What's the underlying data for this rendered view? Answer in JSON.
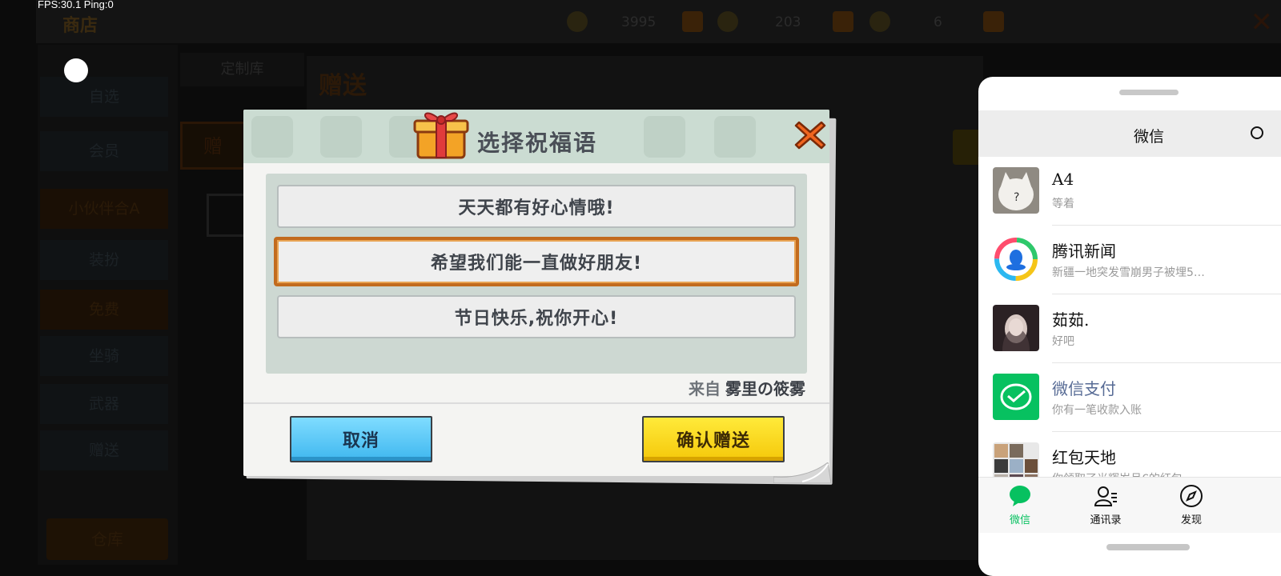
{
  "overlay": {
    "fps_text": "FPS:30.1 Ping:0"
  },
  "game_background": {
    "title": "商店",
    "currencies": [
      "3995",
      "203",
      "6"
    ],
    "sidebar": [
      "自选",
      "会员",
      "小伙伴合A",
      "装扮",
      "免费",
      "坐骑",
      "武器",
      "赠送"
    ],
    "sidebar_bottom": "仓库",
    "tab_library": "定制库",
    "panel_title": "赠送",
    "tab_active": "赠"
  },
  "dialog": {
    "title": "选择祝福语",
    "options": [
      {
        "text": "天天都有好心情哦!",
        "selected": false
      },
      {
        "text": "希望我们能一直做好朋友!",
        "selected": true
      },
      {
        "text": "节日快乐,祝你开心!",
        "selected": false
      }
    ],
    "from_label": "来自",
    "from_name": "雾里の筱雾",
    "cancel_label": "取消",
    "confirm_label": "确认赠送",
    "colors": {
      "cancel": "#4cc3f5",
      "confirm": "#f8d317",
      "selected_border": "#c26b1e"
    }
  },
  "wechat": {
    "title": "微信",
    "chats": [
      {
        "name": "A4",
        "message": "等着",
        "avatar": "white-cat-avatar"
      },
      {
        "name": "腾讯新闻",
        "message": "新疆一地突发雪崩男子被埋5…",
        "avatar": "tencent-news-logo"
      },
      {
        "name": "茹茹.",
        "message": "好吧",
        "avatar": "anime-girl-avatar"
      },
      {
        "name": "微信支付",
        "message": "你有一笔收款入账",
        "avatar": "wechat-pay-logo"
      },
      {
        "name": "红包天地",
        "message": "你领取了光辉岁月€的红包",
        "avatar": "group-avatar-grid"
      }
    ],
    "tabs": [
      {
        "label": "微信",
        "icon": "chat-bubble-icon",
        "active": true
      },
      {
        "label": "通讯录",
        "icon": "contacts-icon",
        "active": false
      },
      {
        "label": "发现",
        "icon": "compass-icon",
        "active": false
      }
    ],
    "colors": {
      "accent": "#07c160",
      "pay_name": "#576b95"
    }
  }
}
